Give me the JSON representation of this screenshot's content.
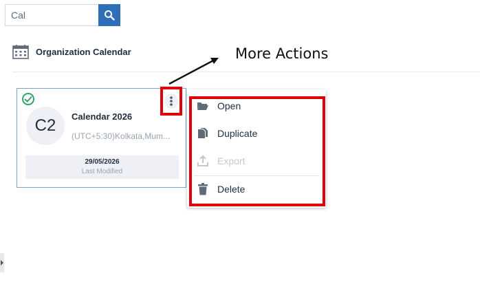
{
  "search": {
    "value": "Cal",
    "icon": "search-icon"
  },
  "section": {
    "title": "Organization Calendar",
    "icon": "calendar-icon"
  },
  "annotation": {
    "text": "More Actions"
  },
  "card": {
    "avatar_initials": "C2",
    "title": "Calendar 2026",
    "subtitle": "(UTC+5:30)Kolkata,Mum...",
    "last_modified_date": "29/05/2026",
    "last_modified_label": "Last Modified",
    "status_icon": "check-circle-icon"
  },
  "menu": {
    "items": [
      {
        "label": "Open",
        "icon": "folder-open-icon",
        "enabled": true
      },
      {
        "label": "Duplicate",
        "icon": "duplicate-icon",
        "enabled": true
      },
      {
        "label": "Export",
        "icon": "export-icon",
        "enabled": false
      },
      {
        "label": "Delete",
        "icon": "trash-icon",
        "enabled": true
      }
    ]
  },
  "colors": {
    "accent": "#2f6fb8",
    "highlight": "#e0000a",
    "success": "#2fa36b"
  }
}
